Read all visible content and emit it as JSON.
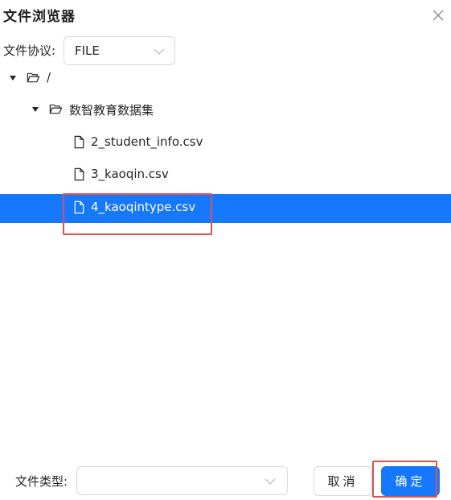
{
  "dialog": {
    "title": "文件浏览器"
  },
  "protocol": {
    "label": "文件协议:",
    "value": "FILE"
  },
  "tree": {
    "root": {
      "label": "/",
      "expanded": true
    },
    "folder": {
      "label": "数智教育数据集",
      "expanded": true
    },
    "files": [
      {
        "label": "2_student_info.csv",
        "selected": false
      },
      {
        "label": "3_kaoqin.csv",
        "selected": false
      },
      {
        "label": "4_kaoqintype.csv",
        "selected": true
      }
    ]
  },
  "file_type": {
    "label": "文件类型:",
    "value": ""
  },
  "buttons": {
    "cancel": "取消",
    "ok": "确定"
  },
  "colors": {
    "selected_row": "#1677ff",
    "primary_button": "#1677ff",
    "highlight_box": "#d9534f"
  }
}
